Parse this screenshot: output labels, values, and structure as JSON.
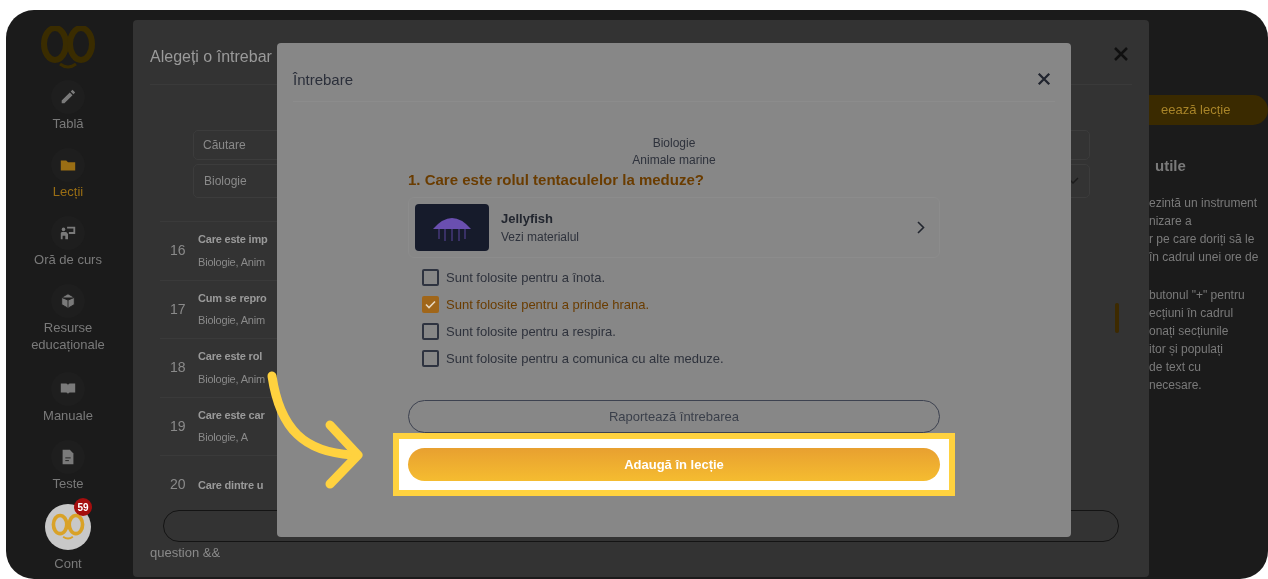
{
  "sidebar": {
    "items": [
      {
        "label": "Tablă",
        "selected": false
      },
      {
        "label": "Lecții",
        "selected": true
      },
      {
        "label": "Oră de curs",
        "selected": false
      },
      {
        "label": "Resurse educaționale",
        "selected": false
      },
      {
        "label": "Manuale",
        "selected": false
      },
      {
        "label": "Teste",
        "selected": false
      }
    ],
    "account": {
      "label": "Cont",
      "badge": "59"
    }
  },
  "background_dialog": {
    "title": "Alegeți o întrebar",
    "search": {
      "placeholder": "Căutare"
    },
    "filter": {
      "value": "Biologie"
    },
    "rows": [
      {
        "number": "16",
        "title": "Care este imp",
        "subtitle": "Biologie, Anim"
      },
      {
        "number": "17",
        "title": "Cum se repro",
        "subtitle": "Biologie, Anim"
      },
      {
        "number": "18",
        "title": "Care este rol",
        "subtitle": "Biologie, Anim"
      },
      {
        "number": "19",
        "title": "Care este car",
        "subtitle": "Biologie, A"
      },
      {
        "number": "20",
        "title": "Care dintre u"
      }
    ],
    "footer_text": "question &&"
  },
  "side_panel": {
    "button": "eează lecție",
    "heading": "utile",
    "paragraphs": [
      [
        "ezintă un instrument",
        "nizare a",
        "r pe care doriți să le",
        "în cadrul unei ore de"
      ],
      [
        "butonul \"+\" pentru",
        "ecțiuni în cadrul",
        "onați secțiunile",
        "itor și populați",
        "de text cu",
        "necesare."
      ]
    ]
  },
  "dialog": {
    "title": "Întrebare",
    "subject": "Biologie",
    "topic": "Animale marine",
    "question": "1. Care este rolul tentaculelor la meduze?",
    "material": {
      "title": "Jellyfish",
      "subtitle": "Vezi materialul"
    },
    "options": [
      {
        "text": "Sunt folosite pentru a înota.",
        "checked": false
      },
      {
        "text": "Sunt folosite pentru a prinde hrana.",
        "checked": true
      },
      {
        "text": "Sunt folosite pentru a respira.",
        "checked": false
      },
      {
        "text": "Sunt folosite pentru a comunica cu alte meduze.",
        "checked": false
      }
    ],
    "report_button": "Raportează întrebarea",
    "add_button": "Adaugă în lecție"
  }
}
